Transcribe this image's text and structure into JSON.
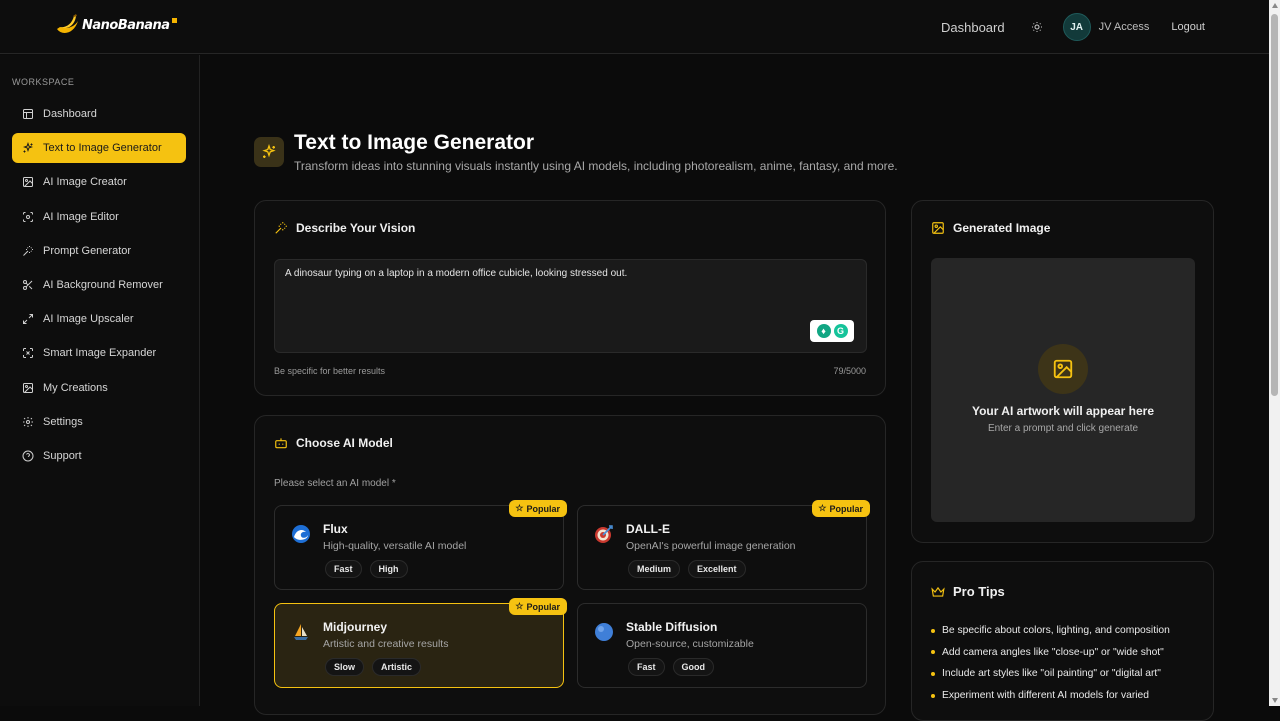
{
  "brand": {
    "name": "NanoBanana"
  },
  "topbar": {
    "dashboard": "Dashboard",
    "avatar_initials": "JA",
    "user_name": "JV Access",
    "logout": "Logout"
  },
  "sidebar": {
    "section": "WORKSPACE",
    "items": [
      {
        "label": "Dashboard",
        "icon": "layout-icon",
        "active": false
      },
      {
        "label": "Text to Image Generator",
        "icon": "sparkles-icon",
        "active": true
      },
      {
        "label": "AI Image Creator",
        "icon": "image-icon",
        "active": false
      },
      {
        "label": "AI Image Editor",
        "icon": "scan-icon",
        "active": false
      },
      {
        "label": "Prompt Generator",
        "icon": "wand-icon",
        "active": false
      },
      {
        "label": "AI Background Remover",
        "icon": "scissors-icon",
        "active": false
      },
      {
        "label": "AI Image Upscaler",
        "icon": "expand-icon",
        "active": false
      },
      {
        "label": "Smart Image Expander",
        "icon": "maximize-icon",
        "active": false
      },
      {
        "label": "My Creations",
        "icon": "image-icon",
        "active": false
      },
      {
        "label": "Settings",
        "icon": "gear-icon",
        "active": false
      },
      {
        "label": "Support",
        "icon": "help-icon",
        "active": false
      }
    ]
  },
  "header": {
    "title": "Text to Image Generator",
    "subtitle": "Transform ideas into stunning visuals instantly using AI models, including photorealism, anime, fantasy, and more."
  },
  "vision": {
    "title": "Describe Your Vision",
    "prompt": "A dinosaur typing on a laptop in a modern office cubicle, looking stressed out.",
    "hint": "Be specific for better results",
    "count": "79/5000"
  },
  "model_section": {
    "title": "Choose AI Model",
    "label": "Please select an AI model *",
    "popular_label": "Popular",
    "models": [
      {
        "name": "Flux",
        "desc": "High-quality, versatile AI model",
        "tags": [
          "Fast",
          "High"
        ],
        "popular": true,
        "selected": false
      },
      {
        "name": "DALL-E",
        "desc": "OpenAI's powerful image generation",
        "tags": [
          "Medium",
          "Excellent"
        ],
        "popular": true,
        "selected": false
      },
      {
        "name": "Midjourney",
        "desc": "Artistic and creative results",
        "tags": [
          "Slow",
          "Artistic"
        ],
        "popular": true,
        "selected": true
      },
      {
        "name": "Stable Diffusion",
        "desc": "Open-source, customizable",
        "tags": [
          "Fast",
          "Good"
        ],
        "popular": false,
        "selected": false
      }
    ]
  },
  "generated": {
    "title": "Generated Image",
    "placeholder_title": "Your AI artwork will appear here",
    "placeholder_sub": "Enter a prompt and click generate"
  },
  "tips": {
    "title": "Pro Tips",
    "items": [
      "Be specific about colors, lighting, and composition",
      "Add camera angles like \"close-up\" or \"wide shot\"",
      "Include art styles like \"oil painting\" or \"digital art\"",
      "Experiment with different AI models for varied"
    ]
  },
  "colors": {
    "accent": "#f5c211",
    "background": "#0b0b0b",
    "card": "#0e0e0e"
  }
}
